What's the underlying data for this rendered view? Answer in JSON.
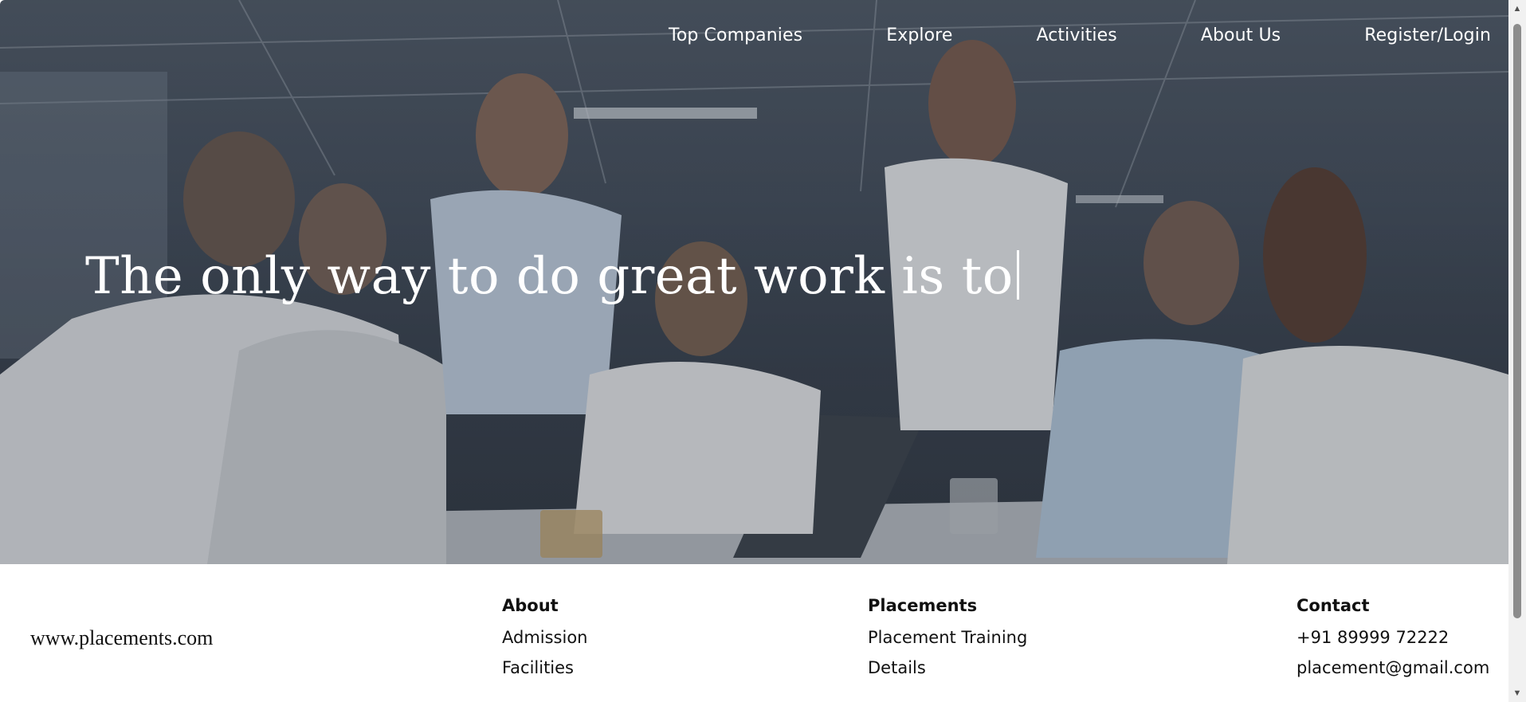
{
  "nav": {
    "items": [
      {
        "label": "Top Companies"
      },
      {
        "label": "Explore"
      },
      {
        "label": "Activities"
      },
      {
        "label": "About Us"
      },
      {
        "label": "Register/Login"
      }
    ]
  },
  "hero": {
    "typed_text": "The only way to do great work is to"
  },
  "footer": {
    "site": "www.placements.com",
    "about": {
      "title": "About",
      "links": [
        "Admission",
        "Facilities"
      ]
    },
    "placements": {
      "title": "Placements",
      "links": [
        "Placement Training",
        "Details"
      ]
    },
    "contact": {
      "title": "Contact",
      "phone": "+91 89999 72222",
      "email": "placement@gmail.com"
    }
  },
  "icons": {
    "scroll_up": "chevron-up-icon",
    "scroll_down": "chevron-down-icon"
  }
}
